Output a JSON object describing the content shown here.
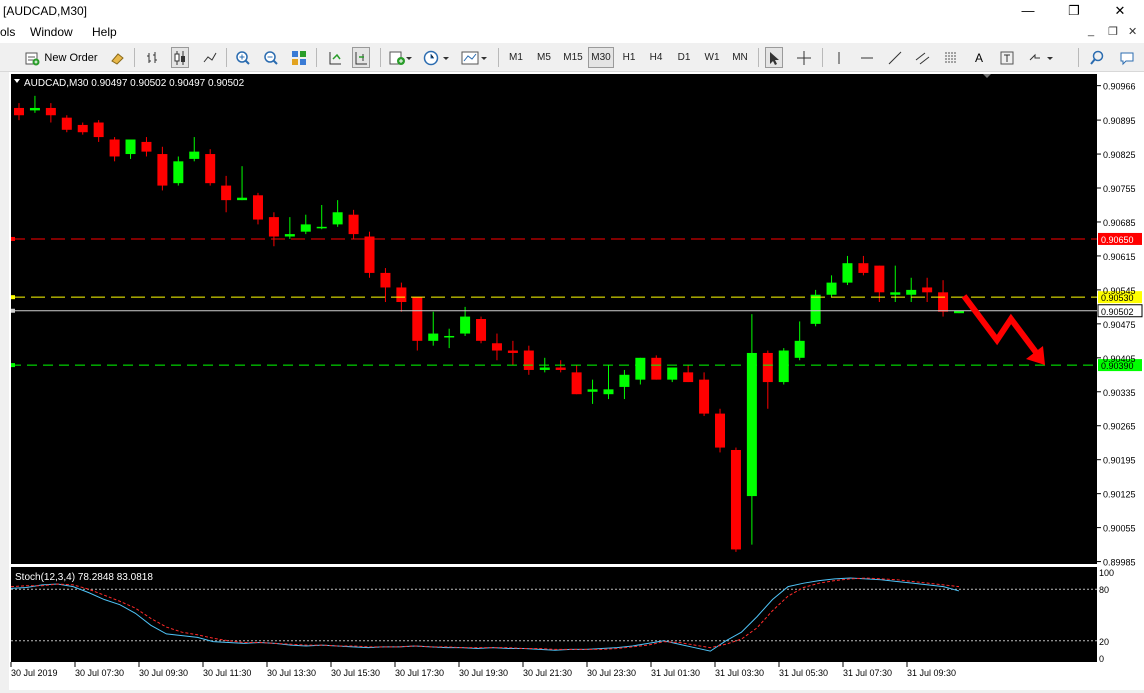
{
  "window": {
    "title": "[AUDCAD,M30]",
    "controls": {
      "minimize": "—",
      "restore": "❐",
      "close": "✕"
    },
    "mdi_controls": {
      "minimize": "_",
      "restore": "❐",
      "close": "✕"
    }
  },
  "menu": [
    "ols",
    "Window",
    "Help"
  ],
  "toolbar": {
    "new_order_label": "New Order",
    "timeframes": [
      "M1",
      "M5",
      "M15",
      "M30",
      "H1",
      "H4",
      "D1",
      "W1",
      "MN"
    ],
    "active_timeframe": "M30",
    "icons": [
      "bar-chart-icon",
      "candles-icon",
      "line-chart-icon",
      "zoom-in-icon",
      "zoom-out-icon",
      "tile-windows-icon",
      "autoscroll-icon",
      "chart-shift-icon",
      "indicators-icon",
      "periods-icon",
      "templates-icon",
      "cursor-icon",
      "crosshair-icon",
      "vertical-line-icon",
      "horizontal-line-icon",
      "trendline-icon",
      "equidistant-channel-icon",
      "fibonacci-icon",
      "text-label-icon",
      "text-icon",
      "arrows-icon",
      "search-icon",
      "community-icon"
    ],
    "text_tool_label": "A"
  },
  "chart": {
    "header": "AUDCAD,M30  0.90497 0.90502 0.90497 0.90502",
    "colors": {
      "bg": "#000000",
      "bull": "#00ff00",
      "bear": "#ff0000",
      "text": "#ffffff",
      "axis_text": "#000000",
      "line_red": "#ff0000",
      "line_yellow": "#ffff00",
      "line_green": "#00ff00",
      "arrow": "#ff0000"
    }
  },
  "chart_data": [
    {
      "type": "candlestick",
      "title": "AUDCAD,M30",
      "ohlc_header": {
        "open": 0.90497,
        "high": 0.90502,
        "low": 0.90497,
        "close": 0.90502
      },
      "ylim": [
        0.8998,
        0.9099
      ],
      "y_tick_labels": [
        "0.90966",
        "0.90895",
        "0.90825",
        "0.90755",
        "0.90685",
        "0.90615",
        "0.90545",
        "0.90475",
        "0.90405",
        "0.90335",
        "0.90265",
        "0.90195",
        "0.90125",
        "0.90055",
        "0.89985"
      ],
      "x_tick_labels": [
        "30 Jul 2019",
        "30 Jul 07:30",
        "30 Jul 09:30",
        "30 Jul 11:30",
        "30 Jul 13:30",
        "30 Jul 15:30",
        "30 Jul 17:30",
        "30 Jul 19:30",
        "30 Jul 21:30",
        "30 Jul 23:30",
        "31 Jul 01:30",
        "31 Jul 03:30",
        "31 Jul 05:30",
        "31 Jul 07:30",
        "31 Jul 09:30"
      ],
      "levels": [
        {
          "price": 0.9065,
          "label": "0.90650",
          "color": "red"
        },
        {
          "price": 0.9053,
          "label": "0.90530",
          "color": "yellow"
        },
        {
          "price": 0.90502,
          "label": "0.90502",
          "color": "white",
          "note": "current price"
        },
        {
          "price": 0.9039,
          "label": "0.90390",
          "color": "green"
        }
      ],
      "annotation": "red down arrow from 0.90530 toward 0.90390",
      "candles": [
        [
          0.9092,
          0.9093,
          0.90895,
          0.90905
        ],
        [
          0.90915,
          0.90945,
          0.9091,
          0.9092
        ],
        [
          0.9092,
          0.9093,
          0.9089,
          0.90905
        ],
        [
          0.909,
          0.90905,
          0.9087,
          0.90875
        ],
        [
          0.90885,
          0.9089,
          0.90865,
          0.9087
        ],
        [
          0.9089,
          0.90895,
          0.9085,
          0.9086
        ],
        [
          0.90855,
          0.9086,
          0.9081,
          0.9082
        ],
        [
          0.90825,
          0.9085,
          0.90815,
          0.90855
        ],
        [
          0.9085,
          0.9086,
          0.9082,
          0.9083
        ],
        [
          0.90825,
          0.9084,
          0.9075,
          0.9076
        ],
        [
          0.90765,
          0.9082,
          0.9076,
          0.9081
        ],
        [
          0.90815,
          0.9086,
          0.9081,
          0.9083
        ],
        [
          0.90825,
          0.90835,
          0.9076,
          0.90765
        ],
        [
          0.9076,
          0.9078,
          0.90705,
          0.9073
        ],
        [
          0.9073,
          0.908,
          0.9073,
          0.90735
        ],
        [
          0.9074,
          0.90745,
          0.9068,
          0.9069
        ],
        [
          0.90695,
          0.90705,
          0.90635,
          0.90655
        ],
        [
          0.90655,
          0.90695,
          0.9065,
          0.9066
        ],
        [
          0.90665,
          0.907,
          0.9066,
          0.9068
        ],
        [
          0.90675,
          0.9072,
          0.9067,
          0.90675
        ],
        [
          0.9068,
          0.9073,
          0.90675,
          0.90705
        ],
        [
          0.907,
          0.9071,
          0.9065,
          0.9066
        ],
        [
          0.90655,
          0.90665,
          0.9057,
          0.9058
        ],
        [
          0.9058,
          0.9059,
          0.9052,
          0.9055
        ],
        [
          0.9055,
          0.9056,
          0.905,
          0.9052
        ],
        [
          0.9053,
          0.9053,
          0.9042,
          0.9044
        ],
        [
          0.9044,
          0.905,
          0.9043,
          0.90455
        ],
        [
          0.9045,
          0.90465,
          0.90425,
          0.9045
        ],
        [
          0.90455,
          0.9051,
          0.9045,
          0.9049
        ],
        [
          0.90485,
          0.9049,
          0.90435,
          0.9044
        ],
        [
          0.90435,
          0.90455,
          0.904,
          0.9042
        ],
        [
          0.9042,
          0.9044,
          0.9039,
          0.90415
        ],
        [
          0.9042,
          0.9043,
          0.9037,
          0.9038
        ],
        [
          0.9038,
          0.90405,
          0.90375,
          0.90385
        ],
        [
          0.90385,
          0.904,
          0.90375,
          0.9038
        ],
        [
          0.90375,
          0.9039,
          0.9033,
          0.9033
        ],
        [
          0.90335,
          0.9036,
          0.9031,
          0.9034
        ],
        [
          0.9033,
          0.9039,
          0.9032,
          0.9034
        ],
        [
          0.90345,
          0.9038,
          0.9032,
          0.9037
        ],
        [
          0.9036,
          0.90405,
          0.9035,
          0.90405
        ],
        [
          0.90405,
          0.9041,
          0.9036,
          0.9036
        ],
        [
          0.9036,
          0.90385,
          0.90355,
          0.90385
        ],
        [
          0.90375,
          0.9039,
          0.90355,
          0.90355
        ],
        [
          0.9036,
          0.90375,
          0.90285,
          0.9029
        ],
        [
          0.9029,
          0.903,
          0.9021,
          0.9022
        ],
        [
          0.90215,
          0.9022,
          0.90005,
          0.9001
        ],
        [
          0.9012,
          0.90495,
          0.9002,
          0.90415
        ],
        [
          0.90415,
          0.9042,
          0.903,
          0.90355
        ],
        [
          0.90355,
          0.90425,
          0.9035,
          0.9042
        ],
        [
          0.90405,
          0.9048,
          0.904,
          0.9044
        ],
        [
          0.90475,
          0.90545,
          0.9047,
          0.90535
        ],
        [
          0.90535,
          0.90575,
          0.9053,
          0.9056
        ],
        [
          0.9056,
          0.90615,
          0.90555,
          0.906
        ],
        [
          0.906,
          0.90615,
          0.90575,
          0.9058
        ],
        [
          0.90595,
          0.90595,
          0.9052,
          0.9054
        ],
        [
          0.90535,
          0.90595,
          0.9052,
          0.9054
        ],
        [
          0.90535,
          0.9057,
          0.9052,
          0.90545
        ],
        [
          0.9055,
          0.9057,
          0.9052,
          0.9054
        ],
        [
          0.9054,
          0.90565,
          0.9049,
          0.905
        ],
        [
          0.90497,
          0.90502,
          0.90497,
          0.90502
        ]
      ]
    },
    {
      "type": "line",
      "title": "Stoch(12,3,4) 78.2848 83.0818",
      "ylim": [
        0,
        100
      ],
      "y_tick_labels": [
        "100",
        "80",
        "20",
        "0"
      ],
      "levels": [
        80,
        20
      ],
      "series": [
        {
          "values": [
            81,
            82,
            85,
            86,
            83,
            76,
            68,
            62,
            52,
            38,
            28,
            26,
            24,
            19,
            18,
            17,
            18,
            17,
            15,
            14,
            15,
            14,
            13,
            12,
            13,
            13,
            14,
            13,
            12,
            12,
            11,
            12,
            11,
            11,
            10,
            9,
            10,
            10,
            11,
            12,
            14,
            17,
            20,
            16,
            12,
            8,
            20,
            30,
            48,
            68,
            83,
            87,
            90,
            92,
            93,
            92,
            91,
            89,
            87,
            85,
            83,
            78
          ]
        },
        {
          "values": [
            83,
            84,
            84,
            86,
            85,
            80,
            73,
            66,
            58,
            46,
            36,
            30,
            27,
            23,
            20,
            18,
            18,
            17,
            16,
            15,
            15,
            14,
            14,
            13,
            13,
            13,
            14,
            13,
            13,
            12,
            12,
            12,
            12,
            11,
            11,
            10,
            10,
            10,
            10,
            11,
            13,
            15,
            19,
            18,
            15,
            12,
            16,
            22,
            35,
            55,
            72,
            82,
            87,
            90,
            92,
            93,
            92,
            91,
            89,
            87,
            85,
            83
          ]
        }
      ]
    }
  ]
}
